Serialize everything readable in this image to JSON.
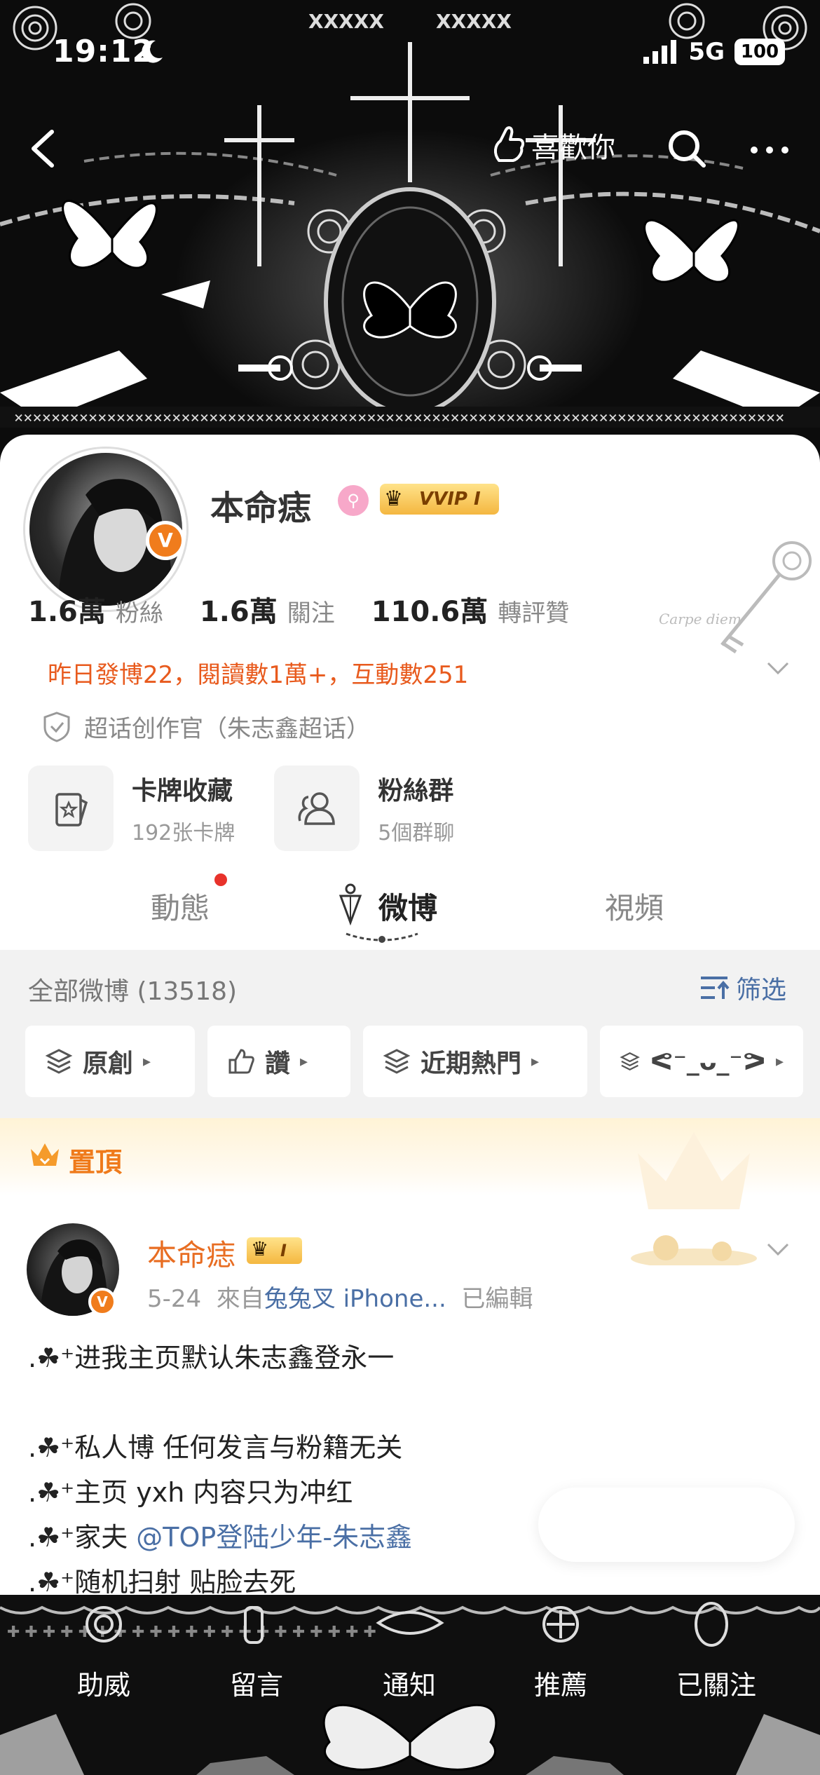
{
  "status_bar": {
    "time": "19:12",
    "network": "5G",
    "battery": "100"
  },
  "nav": {
    "like_label": "喜歡你"
  },
  "profile": {
    "name": "本命痣",
    "vip_label": "VVIP I",
    "stats": [
      {
        "value": "1.6萬",
        "label": "粉絲"
      },
      {
        "value": "1.6萬",
        "label": "關注"
      },
      {
        "value": "110.6萬",
        "label": "轉評贊"
      }
    ],
    "yesterday_summary": "昨日發博22，閱讀數1萬+，互動數251",
    "creator_title": "超话创作官（朱志鑫超话）",
    "cards": [
      {
        "title": "卡牌收藏",
        "subtitle": "192张卡牌"
      },
      {
        "title": "粉絲群",
        "subtitle": "5個群聊"
      }
    ],
    "tabs": [
      {
        "label": "動態"
      },
      {
        "label": "微博"
      },
      {
        "label": "視頻"
      }
    ]
  },
  "filter": {
    "all_label": "全部微博 (13518)",
    "filter_label": "筛选",
    "chips": [
      {
        "label": "原創"
      },
      {
        "label": "讚"
      },
      {
        "label": "近期熱門"
      },
      {
        "label": "ᕙ⁻_ᴗ_⁻ᕗ"
      }
    ]
  },
  "post": {
    "pinned_label": "置頂",
    "author": "本命痣",
    "badge": "I",
    "date": "5-24",
    "source_prefix": "來自",
    "source": "兔兔叉 iPhone...",
    "edited": "已編輯",
    "lines": [
      {
        "prefix": ".☘︎⁺",
        "text": "进我主页默认朱志鑫登永一"
      },
      {
        "prefix": "",
        "text": ""
      },
      {
        "prefix": ".☘︎⁺",
        "text": "私人博 任何发言与粉籍无关"
      },
      {
        "prefix": ".☘︎⁺",
        "text": "主页 yxh 内容只为冲红"
      },
      {
        "prefix": ".☘︎⁺",
        "text": "家夫 "
      },
      {
        "prefix": ".☘︎⁺",
        "text": "随机扫射 贴脸去死"
      }
    ],
    "mention": "@TOP登陆少年-朱志鑫"
  },
  "toolbar": {
    "items": [
      {
        "label": "助威"
      },
      {
        "label": "留言"
      },
      {
        "label": "通知"
      },
      {
        "label": "推薦"
      },
      {
        "label": "已關注"
      }
    ]
  },
  "colors": {
    "accent_orange": "#e85a1d",
    "link_blue": "#4a6fa5",
    "banner_bg": "#0c0c0c",
    "vip_gold": "#f4b740"
  },
  "icons": [
    "back-icon",
    "like-hand-icon",
    "search-icon",
    "more-icon",
    "shield-icon",
    "card-icon",
    "group-icon",
    "chevron-down-icon",
    "filter-icon",
    "layers-icon",
    "thumb-up-icon",
    "crown-icon"
  ]
}
